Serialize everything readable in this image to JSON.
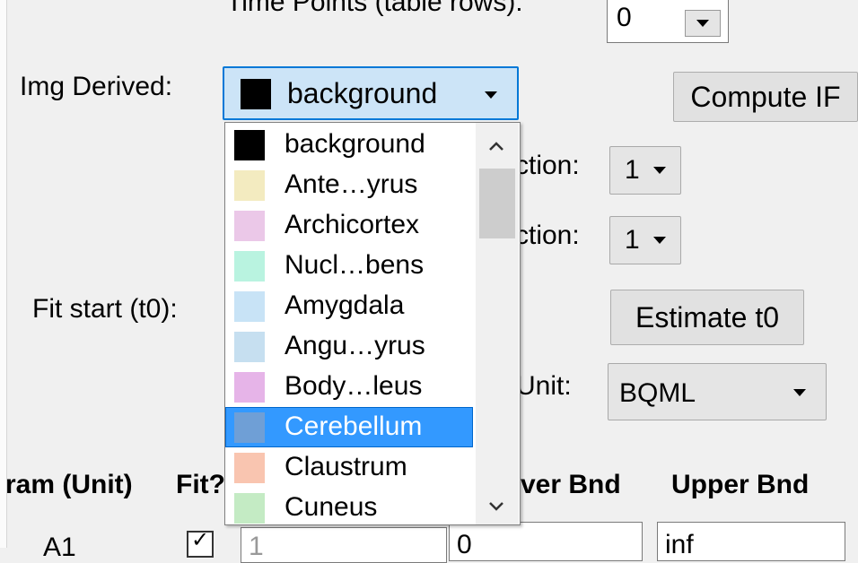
{
  "labels": {
    "time_points": "Time Points (table rows):",
    "img_derived": "Img Derived:",
    "fit_start": "Fit start (t0):",
    "section_1": "ction:",
    "section_2": "ction:",
    "unit": "Unit:"
  },
  "time_points_value": "0",
  "img_derived_select": {
    "selected": "background",
    "selected_color": "#000000"
  },
  "buttons": {
    "compute_if": "Compute IF",
    "estimate_t0": "Estimate t0"
  },
  "selects": {
    "section_1_value": "1",
    "section_2_value": "1",
    "unit_value": "BQML"
  },
  "dropdown_items": [
    {
      "label": "background",
      "color": "#000000"
    },
    {
      "label": "Ante…yrus",
      "color": "#f3ebc0"
    },
    {
      "label": "Archicortex",
      "color": "#ebc8e8"
    },
    {
      "label": "Nucl…bens",
      "color": "#b9f3e0"
    },
    {
      "label": "Amygdala",
      "color": "#c8e3f6"
    },
    {
      "label": "Angu…yrus",
      "color": "#c6dff0"
    },
    {
      "label": "Body…leus",
      "color": "#e6b4e8"
    },
    {
      "label": "Cerebellum",
      "color": "#6f9fd6",
      "selected": true
    },
    {
      "label": "Claustrum",
      "color": "#f9c5b0"
    },
    {
      "label": "Cuneus",
      "color": "#c4ebc4"
    }
  ],
  "table": {
    "headers": [
      "ram (Unit)",
      "Fit?",
      "ver Bnd",
      "Upper Bnd"
    ],
    "row": {
      "name": "A1",
      "fit_checked": true,
      "value": "1",
      "lower": "0",
      "upper": "inf"
    }
  },
  "icons": {
    "scroll_up": "▲",
    "scroll_down": "▼"
  }
}
